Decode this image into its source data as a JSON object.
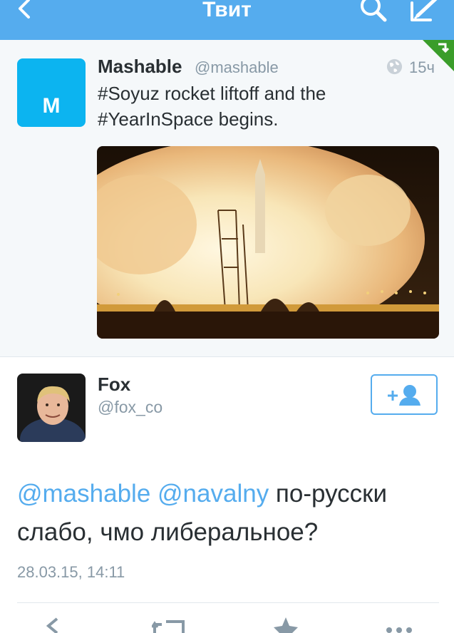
{
  "nav": {
    "title": "Твит",
    "back_icon": "chevron-left-icon",
    "search_icon": "search-icon",
    "compose_icon": "compose-icon"
  },
  "quoted_tweet": {
    "avatar_letter": "M",
    "name": "Mashable",
    "handle": "@mashable",
    "time": "15ч",
    "text_line1": "#Soyuz rocket liftoff and the",
    "text_line2": "#YearInSpace begins.",
    "image_description_icon": "rocket-launch-image"
  },
  "main_tweet": {
    "name": "Fox",
    "handle": "@fox_co",
    "mention1": "@mashable",
    "mention2": "@navalny",
    "text_part1": " по-русски",
    "text_part2": "слабо, чмо либеральное?",
    "date": "28.03.15, 14:11",
    "follow_icon": "follow-user-icon"
  },
  "colors": {
    "brand_blue": "#55acee",
    "mashable_blue": "#0cb4f0",
    "badge_green": "#3a9d2a",
    "muted_gray": "#8899a6"
  }
}
